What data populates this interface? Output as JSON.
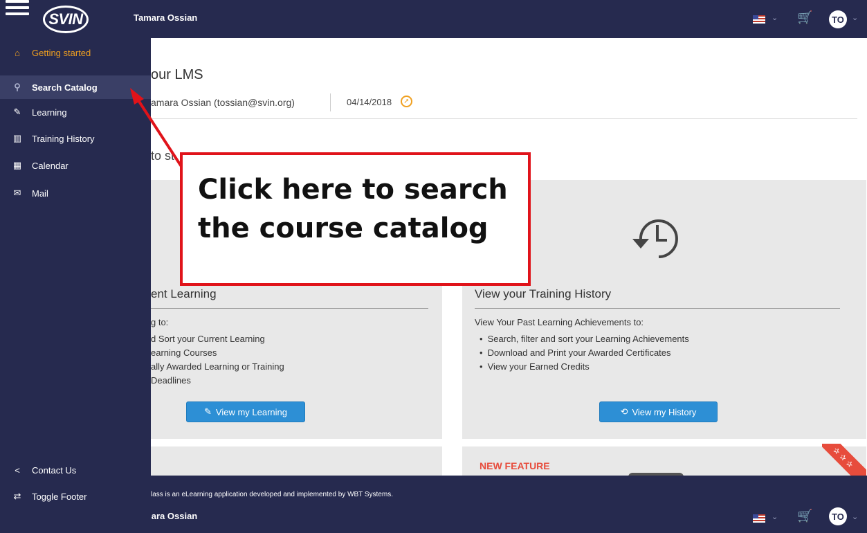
{
  "header": {
    "logo_text": "SVIN",
    "user_name": "Tamara Ossian",
    "avatar_initials": "TO"
  },
  "sidebar": {
    "items": [
      {
        "label": "Getting started",
        "icon": "home-icon"
      },
      {
        "label": "Search Catalog",
        "icon": "search-icon"
      },
      {
        "label": "Learning",
        "icon": "edit-icon"
      },
      {
        "label": "Training History",
        "icon": "history-icon"
      },
      {
        "label": "Calendar",
        "icon": "calendar-icon"
      },
      {
        "label": "Mail",
        "icon": "mail-icon"
      }
    ],
    "bottom": [
      {
        "label": "Contact Us",
        "icon": "share-icon"
      },
      {
        "label": "Toggle Footer",
        "icon": "swap-icon"
      }
    ]
  },
  "main": {
    "title": "our LMS",
    "user_info": "amara Ossian (tossian@svin.org)",
    "date": "04/14/2018",
    "section_question": "to st",
    "current_learning": {
      "title": "ent Learning",
      "intro": "g to:",
      "items": [
        "d Sort your Current Learning",
        "earning Courses",
        "ally Awarded Learning or Training",
        "Deadlines"
      ],
      "button": "View my Learning"
    },
    "training_history": {
      "title": "View your Training History",
      "intro": "View Your Past Learning Achievements to:",
      "items": [
        "Search, filter and sort your Learning Achievements",
        "Download and Print your Awarded Certificates",
        "View your Earned Credits"
      ],
      "button": "View my History"
    },
    "new_feature": "NEW FEATURE"
  },
  "footer": {
    "text": "lass is an eLearning application developed and implemented by WBT Systems."
  },
  "annotation": {
    "line1": "Click here to search",
    "line2": "the course catalog"
  },
  "colors": {
    "navy": "#262a4f",
    "accent_orange": "#f0a020",
    "button_blue": "#2d8fd5",
    "annotation_red": "#e0131a"
  }
}
